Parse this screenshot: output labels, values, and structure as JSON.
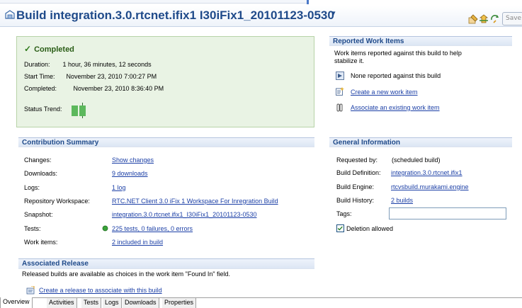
{
  "header": {
    "title": "Build integration.3.0.rtcnet.ifix1 I30iFix1_20101123-0530",
    "caret": "▾",
    "save_label": "Save"
  },
  "status": {
    "title": "Completed",
    "duration_label": "Duration:",
    "duration_value": "1 hour, 36 minutes, 12 seconds",
    "start_label": "Start Time:",
    "start_value": "November 23, 2010 7:00:27 PM",
    "completed_label": "Completed:",
    "completed_value": "November 23, 2010 8:36:40 PM",
    "trend_label": "Status Trend:",
    "colors": {
      "box_bg": "#e9f3e4",
      "trend_bar": "#5cb85c"
    }
  },
  "contribution": {
    "title": "Contribution Summary",
    "rows": [
      {
        "label": "Changes:",
        "value": "Show changes"
      },
      {
        "label": "Downloads:",
        "value": "9 downloads"
      },
      {
        "label": "Logs:",
        "value": "1 log"
      },
      {
        "label": "Repository Workspace:",
        "value": "RTC.NET Client 3.0 iFix 1 Workspace For Inregration Build"
      },
      {
        "label": "Snapshot:",
        "value": "integration.3.0.rtcnet.ifix1_I30iFix1_20101123-0530"
      },
      {
        "label": "Tests:",
        "value": "225 tests, 0 failures, 0 errors"
      },
      {
        "label": "Work items:",
        "value": "2 included in build"
      }
    ]
  },
  "associated_release": {
    "title": "Associated Release",
    "description": "Released builds are available as choices in the work item \"Found In\" field.",
    "create_link": "Create a release to associate with this build"
  },
  "reported_work_items": {
    "title": "Reported Work Items",
    "description_line1": "Work items reported against this build to help",
    "description_line2": "stabilize it.",
    "none_text": "None reported against this build",
    "create_link": "Create a new work item",
    "associate_link": "Associate an existing work item"
  },
  "general_info": {
    "title": "General Information",
    "requested_label": "Requested by:",
    "requested_value": "(scheduled build)",
    "definition_label": "Build Definition:",
    "definition_value": "integration.3.0.rtcnet.ifix1",
    "engine_label": "Build Engine:",
    "engine_value": "rtcvsbuild.murakami.engine",
    "history_label": "Build History:",
    "history_value": "2 builds",
    "tags_label": "Tags:",
    "tags_value": "",
    "deletion_label": "Deletion allowed",
    "deletion_checked": true
  },
  "tabs": [
    "Overview",
    "Activities",
    "Tests",
    "Logs",
    "Downloads",
    "Properties"
  ],
  "icons": {
    "build": "build-icon",
    "status_check": "check-icon",
    "tests_ok": "green-dot-icon",
    "none_reported": "work-item-icon",
    "create_work_item": "new-work-item-icon",
    "associate_work_item": "link-icon",
    "create_release": "release-icon"
  },
  "colors": {
    "title": "#1f4a8a",
    "link": "#1b3fa6",
    "section_head": "#dce6f4"
  }
}
